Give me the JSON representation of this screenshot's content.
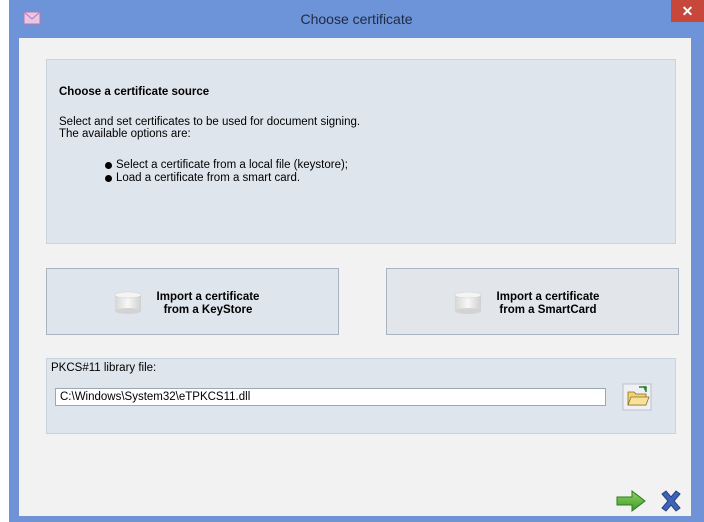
{
  "window": {
    "title": "Choose certificate",
    "close_glyph": "✕",
    "app_icon": "envelope-icon"
  },
  "info": {
    "title": "Choose a certificate source",
    "description": "Select and set certificates to be used for document signing.\nThe available options are:",
    "bullets": [
      "Select a certificate from a local file (keystore);",
      "Load a certificate from a smart card."
    ]
  },
  "sources": {
    "keystore_label": "Import a certificate from a KeyStore",
    "keystore_line1": "Import a certificate",
    "keystore_line2": "from a KeyStore",
    "smartcard_line1": "Import a certificate",
    "smartcard_line2": "from a SmartCard",
    "icon": "cylinder-icon"
  },
  "pkcs": {
    "label": "PKCS#11 library file:",
    "value": "C:\\Windows\\System32\\eTPKCS11.dll",
    "browse_icon": "folder-open-icon"
  },
  "footer": {
    "ok_icon": "green-arrow-icon",
    "cancel_icon": "blue-x-icon"
  },
  "colors": {
    "titlebar": "#6d93d8",
    "panel": "#dfe5ec",
    "close": "#c7473a"
  }
}
